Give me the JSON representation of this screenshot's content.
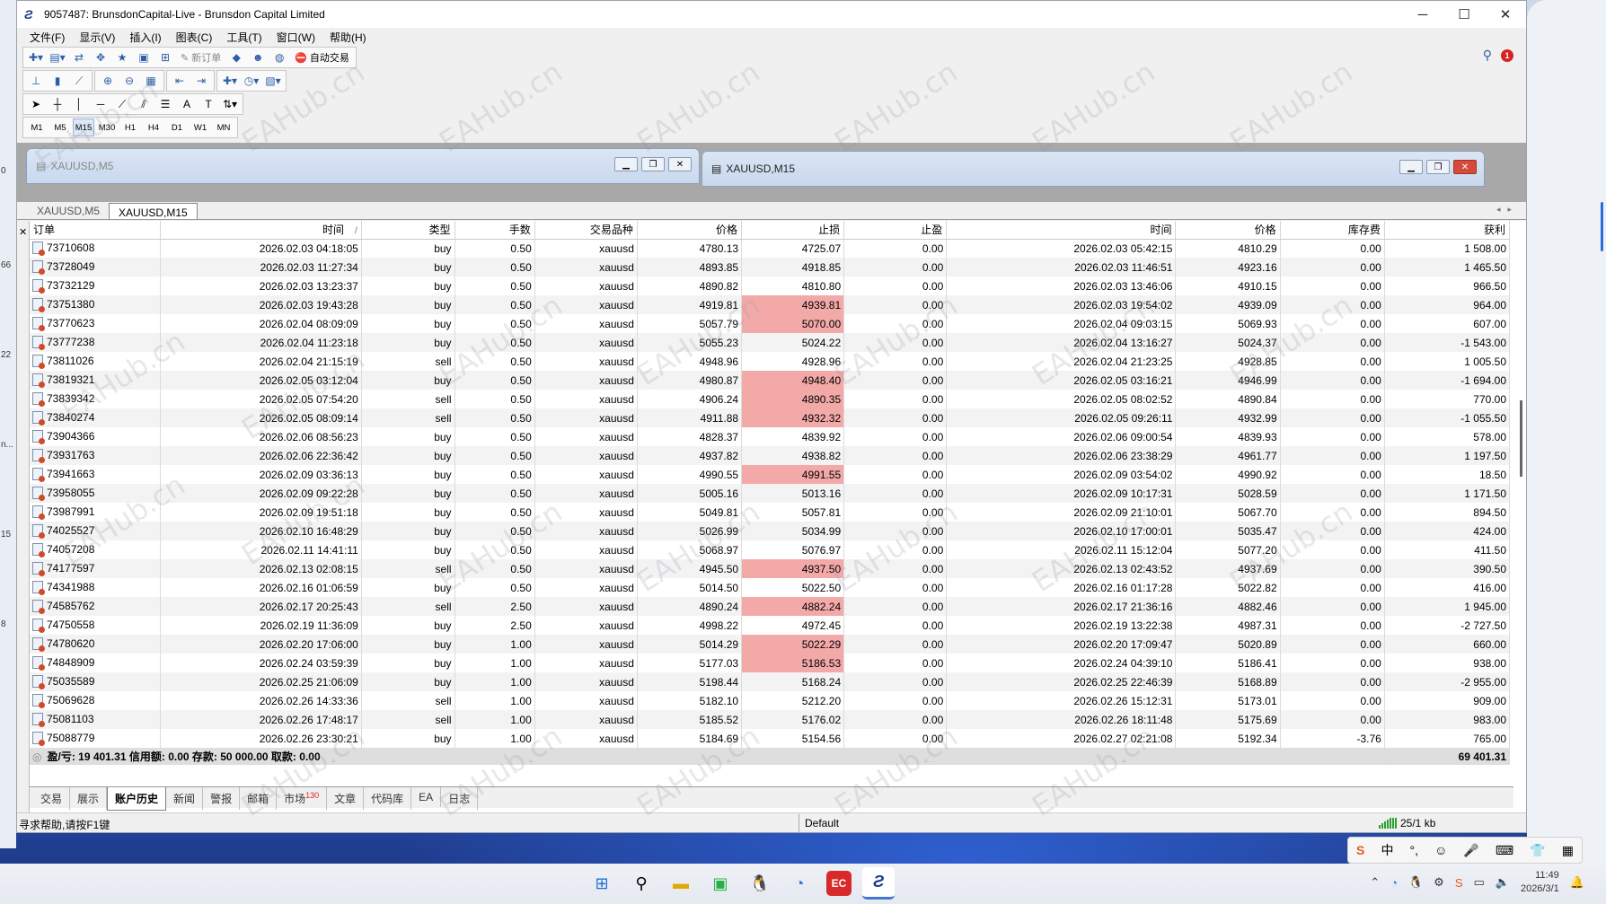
{
  "window": {
    "title": "9057487: BrunsdonCapital-Live - Brunsdon Capital Limited",
    "minimize": "─",
    "maximize": "☐",
    "close": "✕"
  },
  "menu": [
    "文件(F)",
    "显示(V)",
    "插入(I)",
    "图表(C)",
    "工具(T)",
    "窗口(W)",
    "帮助(H)"
  ],
  "toolbar": {
    "new_order": "新订单",
    "auto_trading": "自动交易"
  },
  "timeframes": [
    "M1",
    "M5",
    "M15",
    "M30",
    "H1",
    "H4",
    "D1",
    "W1",
    "MN"
  ],
  "active_timeframe": "M15",
  "alert_count": "1",
  "child_windows": [
    "XAUUSD,M5",
    "XAUUSD,M15"
  ],
  "chart_tabs": [
    {
      "label": "XAUUSD,M5",
      "active": false
    },
    {
      "label": "XAUUSD,M15",
      "active": true
    }
  ],
  "columns": [
    "订单",
    "时间",
    "类型",
    "手数",
    "交易品种",
    "价格",
    "止损",
    "止盈",
    "时间",
    "价格",
    "库存费",
    "获利"
  ],
  "sort_indicator": "/",
  "rows": [
    {
      "order": "73710608",
      "open_time": "2026.02.03 04:18:05",
      "type": "buy",
      "lots": "0.50",
      "symbol": "xauusd",
      "open_price": "4780.13",
      "sl": "4725.07",
      "tp": "0.00",
      "close_time": "2026.02.03 05:42:15",
      "close_price": "4810.29",
      "swap": "0.00",
      "profit": "1 508.00",
      "sl_hit": false
    },
    {
      "order": "73728049",
      "open_time": "2026.02.03 11:27:34",
      "type": "buy",
      "lots": "0.50",
      "symbol": "xauusd",
      "open_price": "4893.85",
      "sl": "4918.85",
      "tp": "0.00",
      "close_time": "2026.02.03 11:46:51",
      "close_price": "4923.16",
      "swap": "0.00",
      "profit": "1 465.50",
      "sl_hit": false
    },
    {
      "order": "73732129",
      "open_time": "2026.02.03 13:23:37",
      "type": "buy",
      "lots": "0.50",
      "symbol": "xauusd",
      "open_price": "4890.82",
      "sl": "4810.80",
      "tp": "0.00",
      "close_time": "2026.02.03 13:46:06",
      "close_price": "4910.15",
      "swap": "0.00",
      "profit": "966.50",
      "sl_hit": false
    },
    {
      "order": "73751380",
      "open_time": "2026.02.03 19:43:28",
      "type": "buy",
      "lots": "0.50",
      "symbol": "xauusd",
      "open_price": "4919.81",
      "sl": "4939.81",
      "tp": "0.00",
      "close_time": "2026.02.03 19:54:02",
      "close_price": "4939.09",
      "swap": "0.00",
      "profit": "964.00",
      "sl_hit": true
    },
    {
      "order": "73770623",
      "open_time": "2026.02.04 08:09:09",
      "type": "buy",
      "lots": "0.50",
      "symbol": "xauusd",
      "open_price": "5057.79",
      "sl": "5070.00",
      "tp": "0.00",
      "close_time": "2026.02.04 09:03:15",
      "close_price": "5069.93",
      "swap": "0.00",
      "profit": "607.00",
      "sl_hit": true
    },
    {
      "order": "73777238",
      "open_time": "2026.02.04 11:23:18",
      "type": "buy",
      "lots": "0.50",
      "symbol": "xauusd",
      "open_price": "5055.23",
      "sl": "5024.22",
      "tp": "0.00",
      "close_time": "2026.02.04 13:16:27",
      "close_price": "5024.37",
      "swap": "0.00",
      "profit": "-1 543.00",
      "sl_hit": false
    },
    {
      "order": "73811026",
      "open_time": "2026.02.04 21:15:19",
      "type": "sell",
      "lots": "0.50",
      "symbol": "xauusd",
      "open_price": "4948.96",
      "sl": "4928.96",
      "tp": "0.00",
      "close_time": "2026.02.04 21:23:25",
      "close_price": "4928.85",
      "swap": "0.00",
      "profit": "1 005.50",
      "sl_hit": false
    },
    {
      "order": "73819321",
      "open_time": "2026.02.05 03:12:04",
      "type": "buy",
      "lots": "0.50",
      "symbol": "xauusd",
      "open_price": "4980.87",
      "sl": "4948.40",
      "tp": "0.00",
      "close_time": "2026.02.05 03:16:21",
      "close_price": "4946.99",
      "swap": "0.00",
      "profit": "-1 694.00",
      "sl_hit": true
    },
    {
      "order": "73839342",
      "open_time": "2026.02.05 07:54:20",
      "type": "sell",
      "lots": "0.50",
      "symbol": "xauusd",
      "open_price": "4906.24",
      "sl": "4890.35",
      "tp": "0.00",
      "close_time": "2026.02.05 08:02:52",
      "close_price": "4890.84",
      "swap": "0.00",
      "profit": "770.00",
      "sl_hit": true
    },
    {
      "order": "73840274",
      "open_time": "2026.02.05 08:09:14",
      "type": "sell",
      "lots": "0.50",
      "symbol": "xauusd",
      "open_price": "4911.88",
      "sl": "4932.32",
      "tp": "0.00",
      "close_time": "2026.02.05 09:26:11",
      "close_price": "4932.99",
      "swap": "0.00",
      "profit": "-1 055.50",
      "sl_hit": true
    },
    {
      "order": "73904366",
      "open_time": "2026.02.06 08:56:23",
      "type": "buy",
      "lots": "0.50",
      "symbol": "xauusd",
      "open_price": "4828.37",
      "sl": "4839.92",
      "tp": "0.00",
      "close_time": "2026.02.06 09:00:54",
      "close_price": "4839.93",
      "swap": "0.00",
      "profit": "578.00",
      "sl_hit": false
    },
    {
      "order": "73931763",
      "open_time": "2026.02.06 22:36:42",
      "type": "buy",
      "lots": "0.50",
      "symbol": "xauusd",
      "open_price": "4937.82",
      "sl": "4938.82",
      "tp": "0.00",
      "close_time": "2026.02.06 23:38:29",
      "close_price": "4961.77",
      "swap": "0.00",
      "profit": "1 197.50",
      "sl_hit": false
    },
    {
      "order": "73941663",
      "open_time": "2026.02.09 03:36:13",
      "type": "buy",
      "lots": "0.50",
      "symbol": "xauusd",
      "open_price": "4990.55",
      "sl": "4991.55",
      "tp": "0.00",
      "close_time": "2026.02.09 03:54:02",
      "close_price": "4990.92",
      "swap": "0.00",
      "profit": "18.50",
      "sl_hit": true
    },
    {
      "order": "73958055",
      "open_time": "2026.02.09 09:22:28",
      "type": "buy",
      "lots": "0.50",
      "symbol": "xauusd",
      "open_price": "5005.16",
      "sl": "5013.16",
      "tp": "0.00",
      "close_time": "2026.02.09 10:17:31",
      "close_price": "5028.59",
      "swap": "0.00",
      "profit": "1 171.50",
      "sl_hit": false
    },
    {
      "order": "73987991",
      "open_time": "2026.02.09 19:51:18",
      "type": "buy",
      "lots": "0.50",
      "symbol": "xauusd",
      "open_price": "5049.81",
      "sl": "5057.81",
      "tp": "0.00",
      "close_time": "2026.02.09 21:10:01",
      "close_price": "5067.70",
      "swap": "0.00",
      "profit": "894.50",
      "sl_hit": false
    },
    {
      "order": "74025527",
      "open_time": "2026.02.10 16:48:29",
      "type": "buy",
      "lots": "0.50",
      "symbol": "xauusd",
      "open_price": "5026.99",
      "sl": "5034.99",
      "tp": "0.00",
      "close_time": "2026.02.10 17:00:01",
      "close_price": "5035.47",
      "swap": "0.00",
      "profit": "424.00",
      "sl_hit": false
    },
    {
      "order": "74057208",
      "open_time": "2026.02.11 14:41:11",
      "type": "buy",
      "lots": "0.50",
      "symbol": "xauusd",
      "open_price": "5068.97",
      "sl": "5076.97",
      "tp": "0.00",
      "close_time": "2026.02.11 15:12:04",
      "close_price": "5077.20",
      "swap": "0.00",
      "profit": "411.50",
      "sl_hit": false
    },
    {
      "order": "74177597",
      "open_time": "2026.02.13 02:08:15",
      "type": "sell",
      "lots": "0.50",
      "symbol": "xauusd",
      "open_price": "4945.50",
      "sl": "4937.50",
      "tp": "0.00",
      "close_time": "2026.02.13 02:43:52",
      "close_price": "4937.69",
      "swap": "0.00",
      "profit": "390.50",
      "sl_hit": true
    },
    {
      "order": "74341988",
      "open_time": "2026.02.16 01:06:59",
      "type": "buy",
      "lots": "0.50",
      "symbol": "xauusd",
      "open_price": "5014.50",
      "sl": "5022.50",
      "tp": "0.00",
      "close_time": "2026.02.16 01:17:28",
      "close_price": "5022.82",
      "swap": "0.00",
      "profit": "416.00",
      "sl_hit": false
    },
    {
      "order": "74585762",
      "open_time": "2026.02.17 20:25:43",
      "type": "sell",
      "lots": "2.50",
      "symbol": "xauusd",
      "open_price": "4890.24",
      "sl": "4882.24",
      "tp": "0.00",
      "close_time": "2026.02.17 21:36:16",
      "close_price": "4882.46",
      "swap": "0.00",
      "profit": "1 945.00",
      "sl_hit": true
    },
    {
      "order": "74750558",
      "open_time": "2026.02.19 11:36:09",
      "type": "buy",
      "lots": "2.50",
      "symbol": "xauusd",
      "open_price": "4998.22",
      "sl": "4972.45",
      "tp": "0.00",
      "close_time": "2026.02.19 13:22:38",
      "close_price": "4987.31",
      "swap": "0.00",
      "profit": "-2 727.50",
      "sl_hit": false
    },
    {
      "order": "74780620",
      "open_time": "2026.02.20 17:06:00",
      "type": "buy",
      "lots": "1.00",
      "symbol": "xauusd",
      "open_price": "5014.29",
      "sl": "5022.29",
      "tp": "0.00",
      "close_time": "2026.02.20 17:09:47",
      "close_price": "5020.89",
      "swap": "0.00",
      "profit": "660.00",
      "sl_hit": true
    },
    {
      "order": "74848909",
      "open_time": "2026.02.24 03:59:39",
      "type": "buy",
      "lots": "1.00",
      "symbol": "xauusd",
      "open_price": "5177.03",
      "sl": "5186.53",
      "tp": "0.00",
      "close_time": "2026.02.24 04:39:10",
      "close_price": "5186.41",
      "swap": "0.00",
      "profit": "938.00",
      "sl_hit": true
    },
    {
      "order": "75035589",
      "open_time": "2026.02.25 21:06:09",
      "type": "buy",
      "lots": "1.00",
      "symbol": "xauusd",
      "open_price": "5198.44",
      "sl": "5168.24",
      "tp": "0.00",
      "close_time": "2026.02.25 22:46:39",
      "close_price": "5168.89",
      "swap": "0.00",
      "profit": "-2 955.00",
      "sl_hit": false
    },
    {
      "order": "75069628",
      "open_time": "2026.02.26 14:33:36",
      "type": "sell",
      "lots": "1.00",
      "symbol": "xauusd",
      "open_price": "5182.10",
      "sl": "5212.20",
      "tp": "0.00",
      "close_time": "2026.02.26 15:12:31",
      "close_price": "5173.01",
      "swap": "0.00",
      "profit": "909.00",
      "sl_hit": false
    },
    {
      "order": "75081103",
      "open_time": "2026.02.26 17:48:17",
      "type": "sell",
      "lots": "1.00",
      "symbol": "xauusd",
      "open_price": "5185.52",
      "sl": "5176.02",
      "tp": "0.00",
      "close_time": "2026.02.26 18:11:48",
      "close_price": "5175.69",
      "swap": "0.00",
      "profit": "983.00",
      "sl_hit": false
    },
    {
      "order": "75088779",
      "open_time": "2026.02.26 23:30:21",
      "type": "buy",
      "lots": "1.00",
      "symbol": "xauusd",
      "open_price": "5184.69",
      "sl": "5154.56",
      "tp": "0.00",
      "close_time": "2026.02.27 02:21:08",
      "close_price": "5192.34",
      "swap": "-3.76",
      "profit": "765.00",
      "sl_hit": false
    }
  ],
  "summary": {
    "text": "盈/亏: 19 401.31  信用额: 0.00  存款: 50 000.00  取款: 0.00",
    "total": "69 401.31"
  },
  "terminal_tabs": [
    {
      "label": "交易",
      "active": false
    },
    {
      "label": "展示",
      "active": false
    },
    {
      "label": "账户历史",
      "active": true
    },
    {
      "label": "新闻",
      "active": false
    },
    {
      "label": "警报",
      "active": false
    },
    {
      "label": "邮箱",
      "active": false
    },
    {
      "label": "市场",
      "active": false,
      "badge": "130"
    },
    {
      "label": "文章",
      "active": false
    },
    {
      "label": "代码库",
      "active": false
    },
    {
      "label": "EA",
      "active": false
    },
    {
      "label": "日志",
      "active": false
    }
  ],
  "status": {
    "help": "寻求帮助,请按F1键",
    "profile": "Default",
    "connection": "25/1 kb"
  },
  "ime": [
    "中",
    "°,",
    "☺",
    "🎤",
    "⌨",
    "👕",
    "▦"
  ],
  "clock": {
    "time": "11:49",
    "date": "2026/3/1"
  },
  "watermark": "EAHub.cn",
  "desk_left_labels": [
    "0",
    "66",
    "22",
    "n...",
    "15",
    "8"
  ],
  "colors": {
    "sl_highlight": "#f4a9a9",
    "row_alt": "#f3f3f3",
    "summary_bg": "#dedede",
    "accent": "#2f5fa8"
  }
}
